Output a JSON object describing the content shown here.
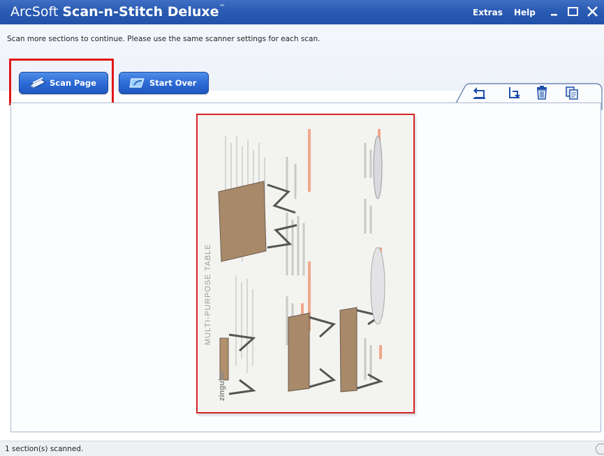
{
  "app": {
    "title_prefix": "ArcSoft ",
    "title_main": "Scan-n-Stitch Deluxe",
    "title_mark": "™"
  },
  "menu": {
    "extras": "Extras",
    "help": "Help"
  },
  "window_controls": {
    "minimize_icon": "minimize-icon",
    "maximize_icon": "maximize-icon",
    "close_icon": "close-icon"
  },
  "instructions": "Scan more sections to continue. Please use the same scanner settings for each scan.",
  "buttons": {
    "scan_page": "Scan Page",
    "start_over": "Start Over"
  },
  "toolbar": {
    "icons": [
      "rotate-left-icon",
      "rotate-right-icon",
      "delete-icon",
      "copy-icon"
    ]
  },
  "preview": {
    "heading": "MULTI-PURPOSE TABLE",
    "brand": "zingular"
  },
  "status": "1 section(s) scanned.",
  "colors": {
    "titlebar": "#2a5bb3",
    "button": "#2d6bd6",
    "highlight": "#e01616"
  }
}
